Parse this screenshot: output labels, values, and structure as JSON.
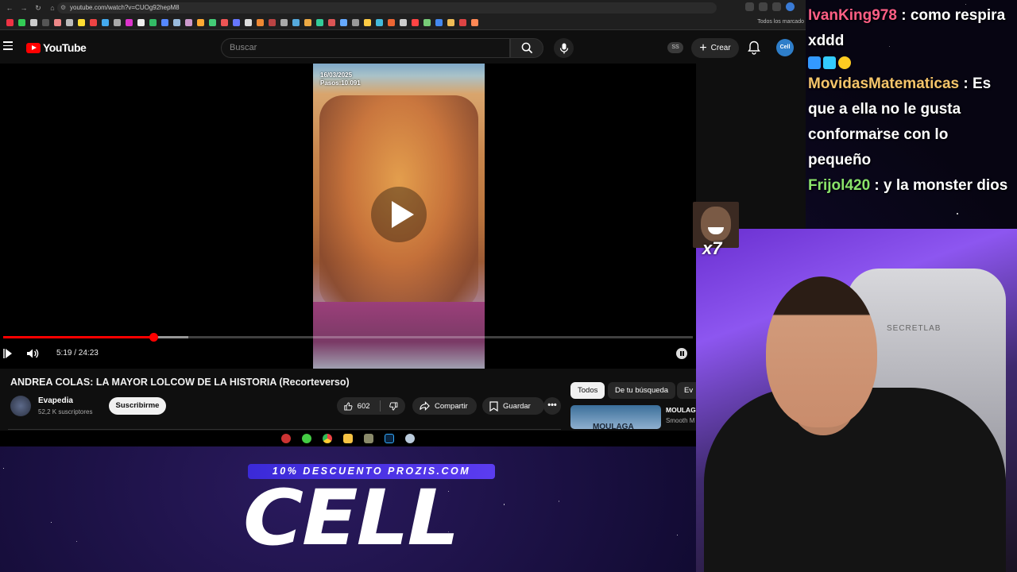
{
  "browser": {
    "url": "youtube.com/watch?v=CUOg92hepM8",
    "bookmarks_all": "Todos los marcado"
  },
  "youtube": {
    "logo_text": "YouTube",
    "search_placeholder": "Buscar",
    "ss_badge": "SS",
    "create_label": "Crear",
    "avatar_text": "Cell"
  },
  "player": {
    "overlay_date": "16/03/2025",
    "overlay_steps": "Pasos:10.091",
    "time": "5:19 / 24:23",
    "progress_fraction": 0.218,
    "buffer_fraction": 0.268
  },
  "video": {
    "title": "ANDREA COLAS: LA MAYOR LOLCOW DE LA HISTORIA (Recorteverso)",
    "channel": "Evapedia",
    "subscribers": "52,2 K suscriptores",
    "subscribe_label": "Suscribirme",
    "likes": "602",
    "share_label": "Compartir",
    "save_label": "Guardar",
    "more_label": "•••"
  },
  "recommendations": {
    "chips": [
      "Todos",
      "De tu búsqueda",
      "Ev"
    ],
    "item_title": "MOULAG",
    "item_channel": "Smooth M",
    "thumb_text": "MOULAGA"
  },
  "chat": [
    {
      "user": "IvanKing978",
      "text": " : como respira xddd"
    },
    {
      "user": "MovidasMatematicas",
      "text": " : Es que a ella no le gusta conformarse con lo pequeño"
    },
    {
      "user": "Frijol420",
      "text": " : y la monster dios"
    }
  ],
  "emote_counter": "x7",
  "webcam": {
    "chair_brand": "SECRETLAB"
  },
  "promo": {
    "banner": "10% DESCUENTO PROZIS.COM",
    "code": "CELL"
  },
  "colors": {
    "yt_red": "#ff0000",
    "chat_user1": "#ff5f85",
    "chat_user2": "#f5c56a",
    "chat_user3": "#8ae36a",
    "promo_banner": "#4a33e6"
  }
}
